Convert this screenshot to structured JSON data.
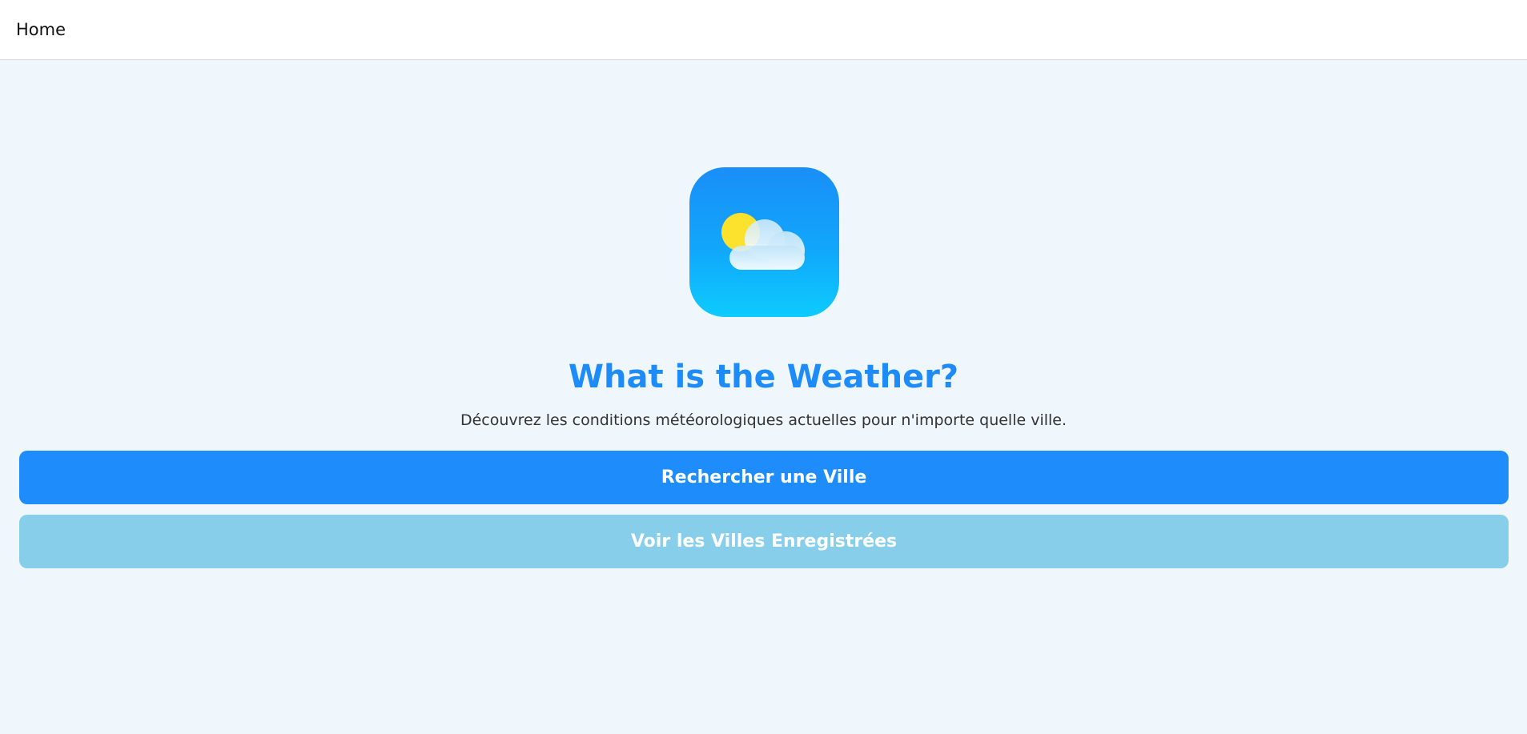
{
  "header": {
    "title": "Home"
  },
  "hero": {
    "logo_icon": "weather-partly-cloudy-icon",
    "title": "What is the Weather?",
    "subtitle": "Découvrez les conditions météorologiques actuelles pour n'importe quelle ville."
  },
  "actions": {
    "search_label": "Rechercher une Ville",
    "saved_label": "Voir les Villes Enregistrées"
  },
  "colors": {
    "background": "#eff6fc",
    "accent": "#1e8cfb",
    "secondary": "#87ceea",
    "title": "#1e8cf8"
  }
}
